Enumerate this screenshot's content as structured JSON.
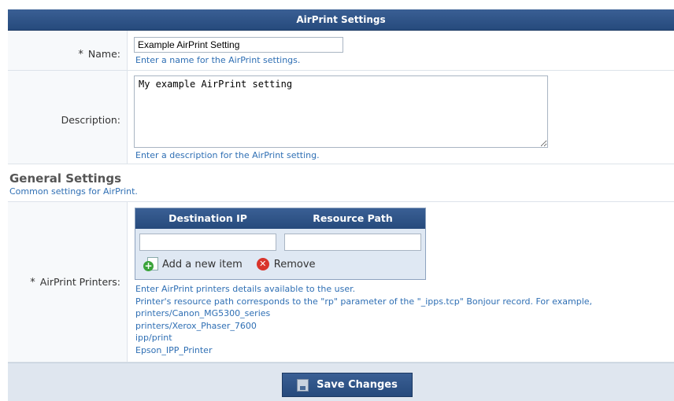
{
  "header": {
    "title": "AirPrint Settings"
  },
  "name": {
    "required_mark": "*",
    "label": "Name:",
    "value": "Example AirPrint Setting",
    "hint": "Enter a name for the AirPrint settings."
  },
  "description": {
    "label": "Description:",
    "value": "My example AirPrint setting",
    "hint": "Enter a description for the AirPrint setting."
  },
  "general": {
    "heading": "General Settings",
    "subheading": "Common settings for AirPrint."
  },
  "printers": {
    "required_mark": "*",
    "label": "AirPrint Printers:",
    "columns": [
      "Destination IP",
      "Resource Path"
    ],
    "destination_ip_value": "",
    "resource_path_value": "",
    "add_label": "Add a new item",
    "remove_label": "Remove",
    "hint_lines": [
      "Enter AirPrint printers details available to the user.",
      "Printer's resource path corresponds to the \"rp\" parameter of the \"_ipps.tcp\" Bonjour record. For example,",
      "printers/Canon_MG5300_series",
      "printers/Xerox_Phaser_7600",
      "ipp/print",
      "Epson_IPP_Printer"
    ]
  },
  "footer": {
    "save_label": "Save Changes"
  },
  "icons": {
    "add": "add-item-icon",
    "remove": "remove-icon",
    "save": "save-disk-icon"
  },
  "colors": {
    "header_bg": "#2f5486",
    "hint_text": "#2f6fb4",
    "label_bg": "#f7f9fb",
    "footer_bg": "#dfe6ef"
  }
}
